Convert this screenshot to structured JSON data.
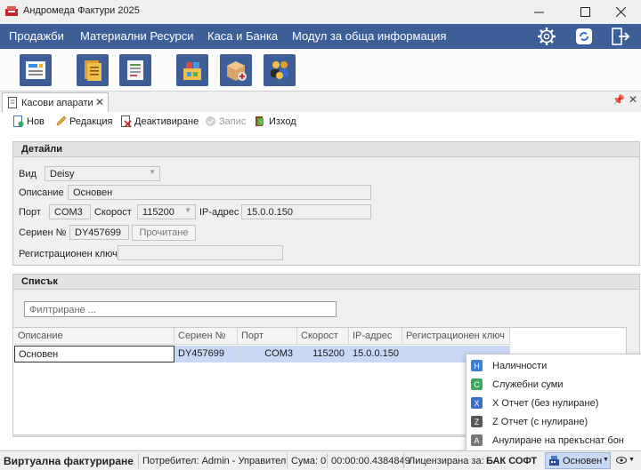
{
  "window": {
    "title": "Андромеда Фактури 2025"
  },
  "menu": {
    "items": [
      "Продажби",
      "Материални Ресурси",
      "Каса и Банка",
      "Модул за обща информация"
    ]
  },
  "ribbon": {
    "icons": [
      "register-icon",
      "documents-icon",
      "report-icon",
      "warehouse-icon",
      "box-add-icon",
      "users-icon"
    ]
  },
  "tab": {
    "label": "Касови апарати"
  },
  "toolbar": {
    "new_label": "Нов",
    "edit_label": "Редакция",
    "deactivate_label": "Деактивиране",
    "save_label": "Запис",
    "exit_label": "Изход"
  },
  "details": {
    "title": "Детайли",
    "type_label": "Вид",
    "type_value": "Deisy",
    "description_label": "Описание",
    "description_value": "Основен",
    "port_label": "Порт",
    "port_value": "COM3",
    "speed_label": "Скорост",
    "speed_value": "115200",
    "ip_label": "IP-адрес",
    "ip_value": "15.0.0.150",
    "serial_label": "Сериен №",
    "serial_value": "DY457699",
    "read_button": "Прочитане",
    "regkey_label": "Регистрационен ключ",
    "regkey_value": ""
  },
  "list": {
    "title": "Списък",
    "filter_placeholder": "Филтриране ...",
    "columns": [
      "Описание",
      "Сериен №",
      "Порт",
      "Скорост",
      "IP-адрес",
      "Регистрационен ключ"
    ],
    "rows": [
      [
        "Основен",
        "DY457699",
        "COM3",
        "115200",
        "15.0.0.150",
        ""
      ]
    ]
  },
  "popup": {
    "items": [
      {
        "badge": "H",
        "label": "Наличности",
        "color": "#3b82d6"
      },
      {
        "badge": "C",
        "label": "Служебни суми",
        "color": "#3aaa5a"
      },
      {
        "badge": "X",
        "label": "X Отчет (без нулиране)",
        "color": "#3b6fc6"
      },
      {
        "badge": "Z",
        "label": "Z Отчет (с нулиране)",
        "color": "#555555"
      },
      {
        "badge": "A",
        "label": "Анулиране на прекъснат бон",
        "color": "#777777"
      }
    ]
  },
  "status": {
    "mode": "Виртуална фактуриране",
    "user": "Потребител: Admin - Управител",
    "sum": "Сума: 0",
    "time": "00:00:00.4384849",
    "licensed_prefix": "Лицензирана за:",
    "licensed_to": "БАК СОФТ",
    "register_button": "Основен"
  },
  "colors": {
    "menubar": "#3d5e96",
    "selection": "#c9d9f3"
  }
}
